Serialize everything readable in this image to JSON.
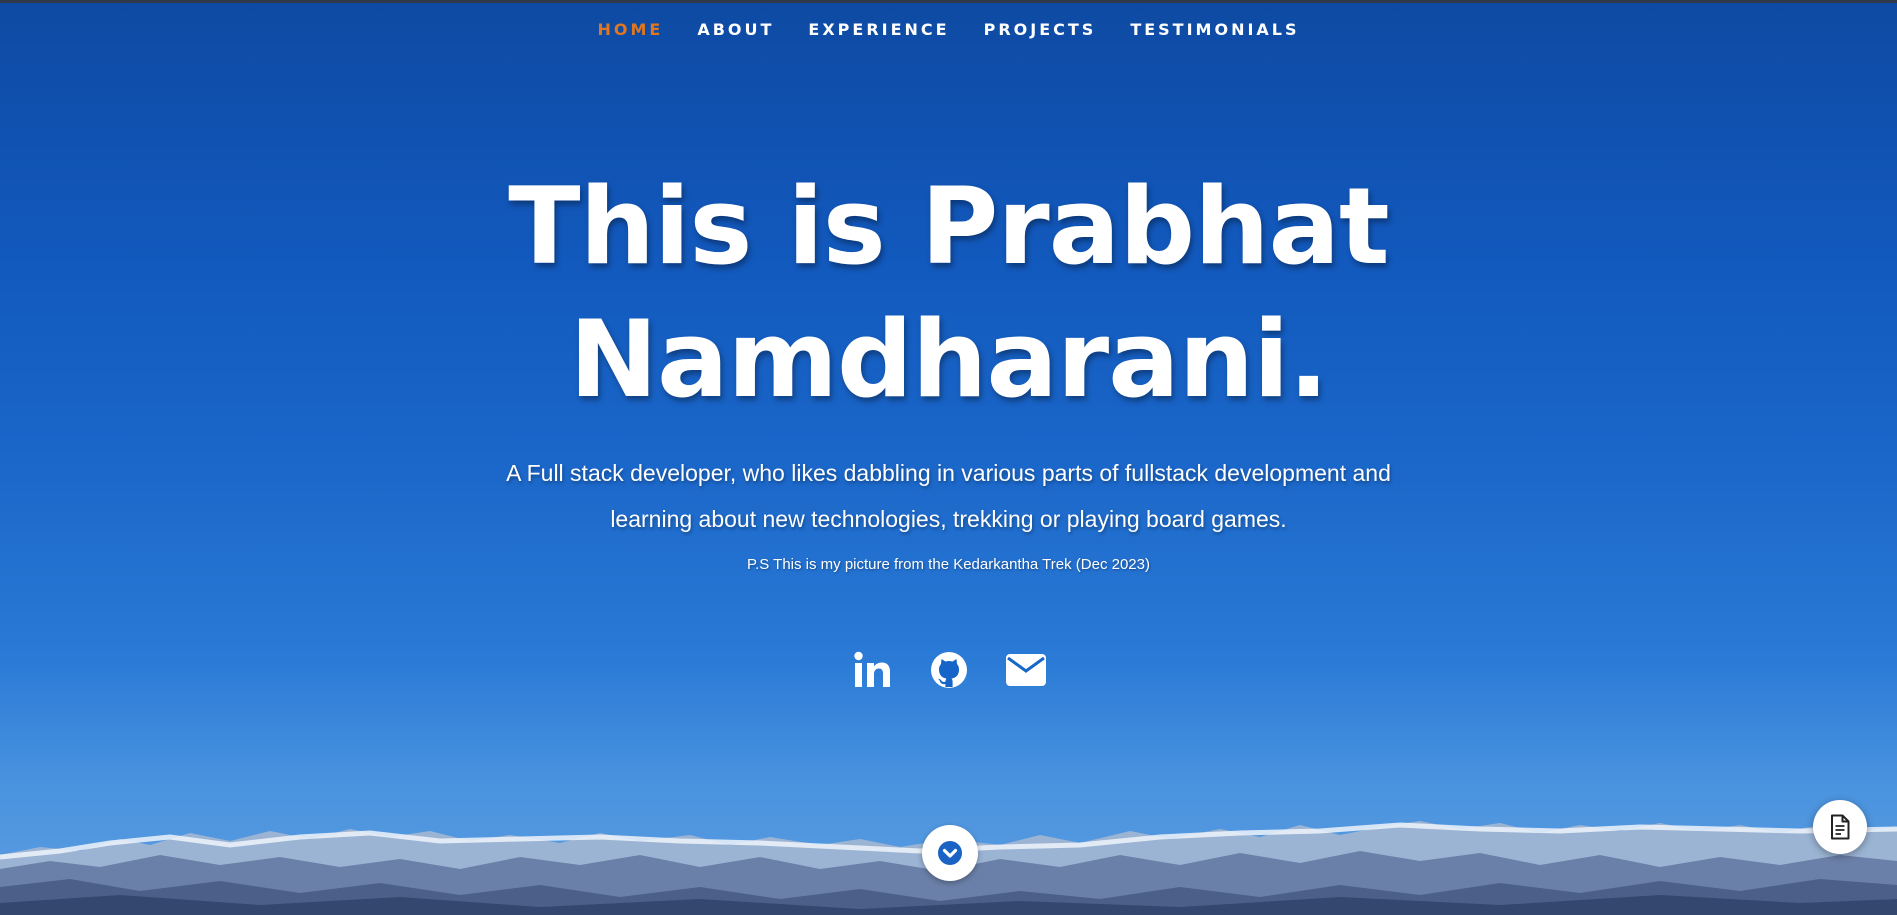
{
  "nav": {
    "items": [
      {
        "label": "HOME",
        "active": true
      },
      {
        "label": "ABOUT",
        "active": false
      },
      {
        "label": "EXPERIENCE",
        "active": false
      },
      {
        "label": "PROJECTS",
        "active": false
      },
      {
        "label": "TESTIMONIALS",
        "active": false
      }
    ],
    "active_color": "#e0761f"
  },
  "hero": {
    "title_line1": "This is Prabhat",
    "title_line2": "Namdharani.",
    "subtitle_line1": "A Full stack developer, who likes dabbling in various parts of fullstack development and",
    "subtitle_line2": "learning about new technologies, trekking or playing board games.",
    "note": "P.S This is my picture from the Kedarkantha Trek (Dec 2023)"
  },
  "socials": {
    "icons": [
      "linkedin-icon",
      "github-icon",
      "email-icon"
    ]
  },
  "controls": {
    "scroll_icon": "chevron-down-icon",
    "resume_icon": "document-icon"
  },
  "colors": {
    "sky_top": "#0e4aa3",
    "sky_bottom": "#5d9ee0",
    "text": "#ffffff"
  }
}
